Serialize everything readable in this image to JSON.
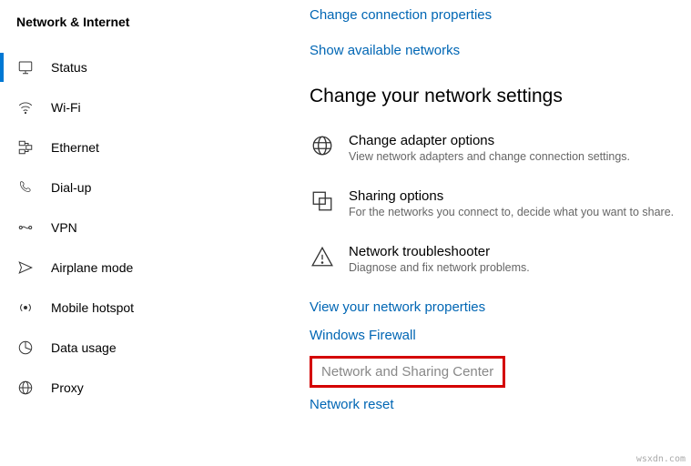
{
  "sidebar": {
    "title": "Network & Internet",
    "items": [
      {
        "label": "Status",
        "active": true
      },
      {
        "label": "Wi-Fi"
      },
      {
        "label": "Ethernet"
      },
      {
        "label": "Dial-up"
      },
      {
        "label": "VPN"
      },
      {
        "label": "Airplane mode"
      },
      {
        "label": "Mobile hotspot"
      },
      {
        "label": "Data usage"
      },
      {
        "label": "Proxy"
      }
    ]
  },
  "topLinks": {
    "changeProps": "Change connection properties",
    "showNetworks": "Show available networks"
  },
  "sectionHeading": "Change your network settings",
  "settings": {
    "adapter": {
      "title": "Change adapter options",
      "desc": "View network adapters and change connection settings."
    },
    "sharing": {
      "title": "Sharing options",
      "desc": "For the networks you connect to, decide what you want to share."
    },
    "troubleshoot": {
      "title": "Network troubleshooter",
      "desc": "Diagnose and fix network problems."
    }
  },
  "bottomLinks": {
    "viewProps": "View your network properties",
    "firewall": "Windows Firewall",
    "sharingCenter": "Network and Sharing Center",
    "reset": "Network reset"
  },
  "watermark": "wsxdn.com"
}
